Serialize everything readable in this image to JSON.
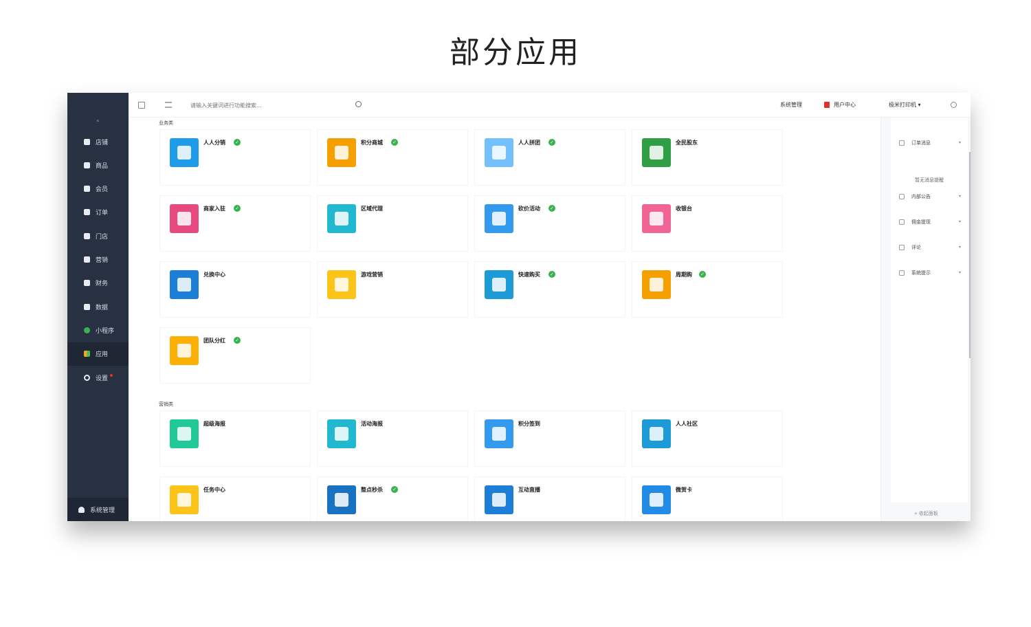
{
  "page_title": "部分应用",
  "sidebar": {
    "collapse_label": "«",
    "items": [
      {
        "label": "店铺",
        "icon": "store-icon"
      },
      {
        "label": "商品",
        "icon": "goods-icon"
      },
      {
        "label": "会员",
        "icon": "member-icon"
      },
      {
        "label": "订单",
        "icon": "order-icon"
      },
      {
        "label": "门店",
        "icon": "shop-icon"
      },
      {
        "label": "营销",
        "icon": "marketing-icon"
      },
      {
        "label": "财务",
        "icon": "finance-icon"
      },
      {
        "label": "数据",
        "icon": "data-icon"
      },
      {
        "label": "小程序",
        "icon": "miniprogram-icon"
      },
      {
        "label": "应用",
        "icon": "apps-icon"
      },
      {
        "label": "设置",
        "icon": "settings-icon"
      }
    ],
    "footer_label": "系统管理"
  },
  "topbar": {
    "search_placeholder": "请输入关键词进行功能搜索...",
    "system_label": "系统管理",
    "user_label": "用户中心",
    "store_label": "极米打印机 ▾"
  },
  "groups": [
    {
      "label": "业务类",
      "apps": [
        {
          "name": "人人分销",
          "checked": true,
          "color": "#1e9be9"
        },
        {
          "name": "积分商城",
          "checked": true,
          "color": "#f59f00"
        },
        {
          "name": "人人拼团",
          "checked": true,
          "color": "#74c0fc"
        },
        {
          "name": "全民股东",
          "checked": false,
          "color": "#2f9e44"
        },
        {
          "name": "商家入驻",
          "checked": true,
          "color": "#e64980"
        },
        {
          "name": "区域代理",
          "checked": false,
          "color": "#22b8cf"
        },
        {
          "name": "砍价活动",
          "checked": true,
          "color": "#339af0"
        },
        {
          "name": "收银台",
          "checked": false,
          "color": "#f06595"
        },
        {
          "name": "兑换中心",
          "checked": false,
          "color": "#1c7ed6"
        },
        {
          "name": "游戏营销",
          "checked": false,
          "color": "#fcc419"
        },
        {
          "name": "快速购买",
          "checked": true,
          "color": "#1c9bd6"
        },
        {
          "name": "周期购",
          "checked": true,
          "color": "#f59f00"
        },
        {
          "name": "团队分红",
          "checked": true,
          "color": "#fab005"
        }
      ]
    },
    {
      "label": "营销类",
      "apps": [
        {
          "name": "超级海报",
          "checked": false,
          "color": "#20c997"
        },
        {
          "name": "活动海报",
          "checked": false,
          "color": "#22b8cf"
        },
        {
          "name": "积分签到",
          "checked": false,
          "color": "#339af0"
        },
        {
          "name": "人人社区",
          "checked": false,
          "color": "#1c9bd6"
        },
        {
          "name": "任务中心",
          "checked": false,
          "color": "#fcc419"
        },
        {
          "name": "整点秒杀",
          "checked": true,
          "color": "#1971c2"
        },
        {
          "name": "互动直播",
          "checked": false,
          "color": "#1c7ed6"
        },
        {
          "name": "微贺卡",
          "checked": false,
          "color": "#228be6"
        }
      ]
    }
  ],
  "right_panel": {
    "items": [
      {
        "label": "订单消息",
        "icon": "order-msg-icon"
      },
      {
        "label": "内部公告",
        "icon": "notice-icon"
      },
      {
        "label": "佣金提现",
        "icon": "withdraw-icon"
      },
      {
        "label": "评论",
        "icon": "comment-icon"
      },
      {
        "label": "系统提示",
        "icon": "system-tip-icon"
      }
    ],
    "empty_text": "暂无消息提醒",
    "collapse_label": "» 收起面板"
  }
}
